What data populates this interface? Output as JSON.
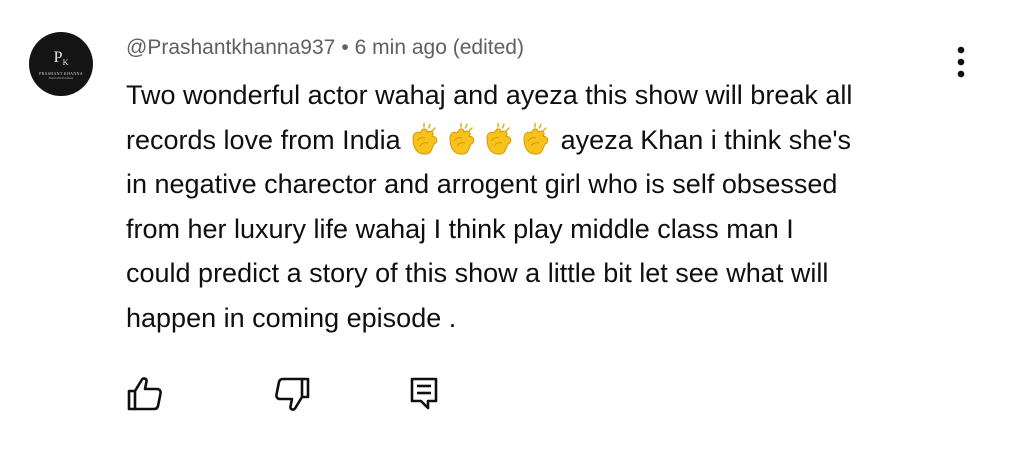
{
  "comment": {
    "author": "@Prashantkhanna937",
    "separator": "•",
    "time": "6 min ago (edited)",
    "avatar": {
      "monogram_main": "P",
      "monogram_small": "K",
      "brand_text": "PRASHANT KHANNA",
      "brand_sub": "Shoot with Prashant"
    },
    "text_lines": [
      "Two wonderful actor wahaj and ayeza this show will break all",
      "records love from India",
      "ayeza Khan i think she's",
      "in negative charector and arrogent girl who is self obsessed",
      "from her luxury life wahaj I think play middle class man I",
      "could predict a story of this show a little bit let see what will",
      "happen in coming episode ."
    ],
    "emojis": [
      "clapping-hands-icon",
      "clapping-hands-icon",
      "clapping-hands-icon",
      "clapping-hands-icon"
    ]
  },
  "actions": {
    "like_icon": "thumbs-up-icon",
    "dislike_icon": "thumbs-down-icon",
    "reply_icon": "reply-icon",
    "more_icon": "more-vertical-icon"
  },
  "colors": {
    "text": "#0f0f0f",
    "meta": "#606060",
    "avatar_bg": "#141414",
    "emoji_yellow": "#f7c21b"
  }
}
